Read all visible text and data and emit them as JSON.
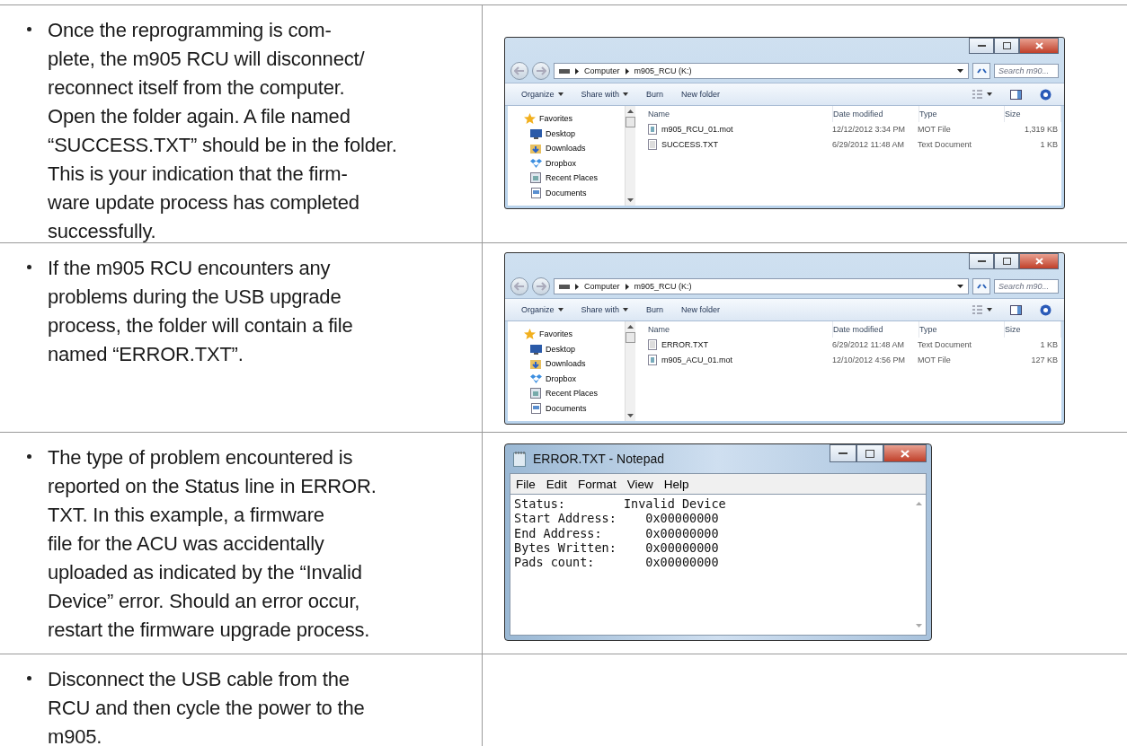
{
  "steps": [
    {
      "text": "Once the reprogramming is com-\nplete, the m905 RCU will disconnect/\nreconnect itself from the computer.\nOpen the folder again.  A file named\n“SUCCESS.TXT” should be in the folder.\nThis is your indication that the firm-\nware update process has completed\nsuccessfully.",
      "figure": {
        "kind": "explorer",
        "path": [
          "Computer",
          "m905_RCU (K:)"
        ],
        "search": {
          "placeholder": "Search m90..."
        },
        "toolbar": [
          "Organize",
          "Share with",
          "Burn",
          "New folder"
        ],
        "sidebar": [
          {
            "label": "Favorites",
            "kind": "star"
          },
          {
            "label": "Desktop",
            "kind": "desktop"
          },
          {
            "label": "Downloads",
            "kind": "downloads"
          },
          {
            "label": "Dropbox",
            "kind": "dropbox"
          },
          {
            "label": "Recent Places",
            "kind": "recent"
          },
          {
            "label": "Documents",
            "kind": "documents"
          }
        ],
        "columns": [
          "Name",
          "Date modified",
          "Type",
          "Size"
        ],
        "rows": [
          {
            "name": "m905_RCU_01.mot",
            "date": "12/12/2012 3:34 PM",
            "type": "MOT File",
            "size": "1,319 KB",
            "kind": "mot"
          },
          {
            "name": "SUCCESS.TXT",
            "date": "6/29/2012 11:48 AM",
            "type": "Text Document",
            "size": "1 KB",
            "kind": "txt"
          }
        ]
      }
    },
    {
      "text": "If the m905 RCU encounters any\nproblems during the USB upgrade\nprocess, the folder will contain a file\nnamed “ERROR.TXT”.",
      "figure": {
        "kind": "explorer",
        "path": [
          "Computer",
          "m905_RCU (K:)"
        ],
        "search": {
          "placeholder": "Search m90..."
        },
        "toolbar": [
          "Organize",
          "Share with",
          "Burn",
          "New folder"
        ],
        "sidebar": [
          {
            "label": "Favorites",
            "kind": "star"
          },
          {
            "label": "Desktop",
            "kind": "desktop"
          },
          {
            "label": "Downloads",
            "kind": "downloads"
          },
          {
            "label": "Dropbox",
            "kind": "dropbox"
          },
          {
            "label": "Recent Places",
            "kind": "recent"
          },
          {
            "label": "Documents",
            "kind": "documents"
          }
        ],
        "columns": [
          "Name",
          "Date modified",
          "Type",
          "Size"
        ],
        "rows": [
          {
            "name": "ERROR.TXT",
            "date": "6/29/2012 11:48 AM",
            "type": "Text Document",
            "size": "1 KB",
            "kind": "txt"
          },
          {
            "name": "m905_ACU_01.mot",
            "date": "12/10/2012 4:56 PM",
            "type": "MOT File",
            "size": "127 KB",
            "kind": "mot"
          }
        ]
      }
    },
    {
      "text": "The type of problem encountered is\nreported on the Status line in ERROR.\nTXT.  In this example, a firmware\nfile for the ACU was accidentally\nuploaded as indicated by the “Invalid\nDevice” error.  Should an error occur,\nrestart the firmware upgrade process.",
      "figure": {
        "kind": "notepad",
        "title": "ERROR.TXT - Notepad",
        "menu": [
          "File",
          "Edit",
          "Format",
          "View",
          "Help"
        ],
        "lines": [
          "Status:        Invalid Device",
          "Start Address:    0x00000000",
          "End Address:      0x00000000",
          "Bytes Written:    0x00000000",
          "Pads count:       0x00000000"
        ]
      }
    },
    {
      "text": "Disconnect the USB cable from the\nRCU and then cycle the power to the\nm905."
    }
  ]
}
